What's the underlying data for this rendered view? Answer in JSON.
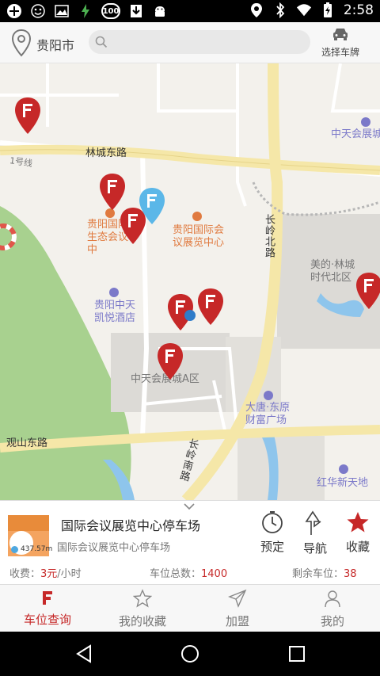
{
  "status_bar": {
    "time": "2:58",
    "badge": "100",
    "icons": [
      "plus-circle-icon",
      "smiley-icon",
      "image-icon",
      "bolt-icon",
      "badge-100-icon",
      "download-icon",
      "android-icon",
      "location-icon",
      "bluetooth-icon",
      "wifi-icon",
      "battery-icon"
    ]
  },
  "header": {
    "city": "贵阳市",
    "search_placeholder": "",
    "plate_label": "选择车牌"
  },
  "map": {
    "roads": {
      "linchengdong": "林城东路",
      "changlingbei": "长岭北路",
      "guanshandong": "观山东路",
      "changlingnan": "长岭南路",
      "line1": "1号线"
    },
    "pois": {
      "intl_conf": "贵阳国际会议展览中心",
      "intl_conf_short": "贵阳国际生态会议中",
      "hotel": "贵阳中天凯悦酒店",
      "zhongtian_a": "中天会展城A区",
      "datang": "大唐·东原财富广场",
      "meide": "美的·林城时代北区",
      "hongyun": "红华新天地",
      "zhongtian_top": "中天会展城"
    }
  },
  "panel": {
    "name": "国际会议展览中心停车场",
    "address": "国际会议展览中心停车场",
    "distance": "437.57m",
    "fee_label": "收费：",
    "fee_value": "3元",
    "fee_unit": "/小时",
    "total_label": "车位总数：",
    "total_value": "1400",
    "remain_label": "剩余车位：",
    "remain_value": "38",
    "actions": {
      "reserve": "预定",
      "navigate": "导航",
      "favorite": "收藏"
    }
  },
  "tabs": [
    {
      "label": "车位查询",
      "active": true
    },
    {
      "label": "我的收藏",
      "active": false
    },
    {
      "label": "加盟",
      "active": false
    },
    {
      "label": "我的",
      "active": false
    }
  ],
  "colors": {
    "accent": "#c62828",
    "map_bg": "#f3f1ec",
    "green_area": "#a8d18f",
    "road": "#ffffff",
    "highway": "#f5e7a8"
  }
}
